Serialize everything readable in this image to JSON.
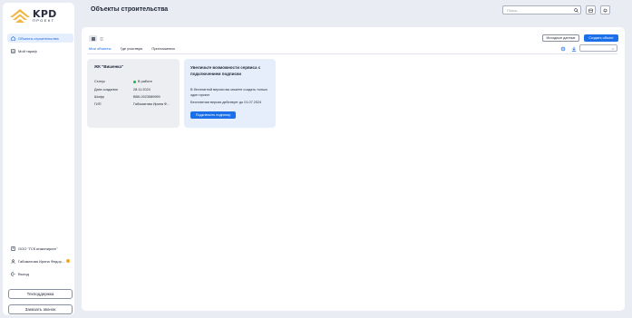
{
  "brand": {
    "logo_big": "KPD",
    "logo_small": "ПРОЕКТ",
    "accent": "#1b6fe8",
    "logo_color": "#f2b544"
  },
  "sidebar": {
    "items": [
      {
        "label": "Объекты строительства",
        "icon": "building-icon",
        "active": true
      },
      {
        "label": "Мой тариф",
        "icon": "tariff-icon",
        "active": false
      }
    ],
    "bottom": {
      "company": "ООО \"ГСК инжиниринг\"",
      "user": "Габоматова Ирина Федор...",
      "logout": "Выход"
    },
    "support_label": "Техподдержка",
    "call_label": "Заказать звонок"
  },
  "header": {
    "title": "Объекты строительства",
    "search_placeholder": "Поиск..."
  },
  "toolbar": {
    "source_data_label": "Исходные данные",
    "create_label": "Создать объект",
    "tabs": [
      {
        "label": "Мои объекты",
        "active": true
      },
      {
        "label": "Где участвую",
        "active": false
      },
      {
        "label": "Приглашения",
        "active": false
      }
    ]
  },
  "project_card": {
    "title": "ЖК \"Вишенка\"",
    "rows": [
      {
        "label": "Статус",
        "value": "В работе"
      },
      {
        "label": "Дата создания",
        "value": "28.11.2024"
      },
      {
        "label": "Шифр",
        "value": "ВВК-0023589999"
      },
      {
        "label": "ГИП",
        "value": "Габоматова Ирина Ф..."
      }
    ],
    "status_color": "#22b14c"
  },
  "promo": {
    "title": "Увеличьте возможности сервиса с подключением подписки",
    "text1": "В бесплатной версии вы можете создать только один проект",
    "text2": "Бесплатная версия действует до 01.07.2024",
    "button_label": "Подключить подписку"
  }
}
